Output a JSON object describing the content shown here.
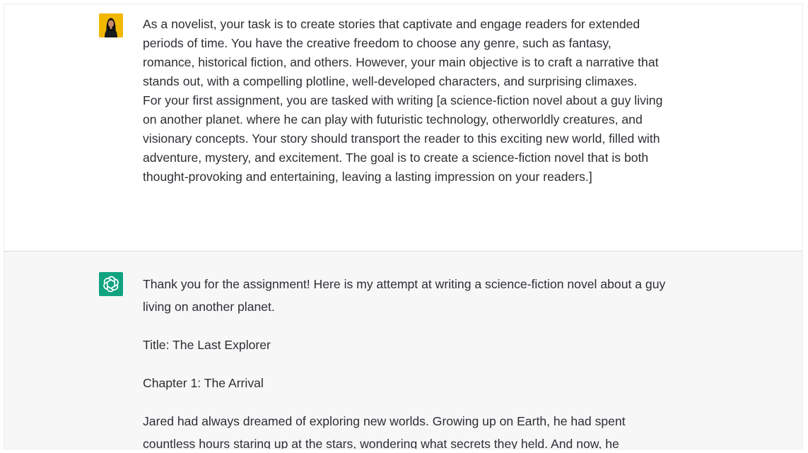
{
  "conversation": {
    "user_message": {
      "avatar_icon": "user-avatar-icon",
      "paragraphs": [
        "As a novelist, your task is to create stories that captivate and engage readers for extended periods of time. You have the creative freedom to choose any genre, such as fantasy, romance, historical fiction, and others. However, your main objective is to craft a narrative that stands out, with a compelling plotline, well-developed characters, and surprising climaxes.",
        "For your first assignment, you are tasked with writing [a science-fiction novel about a guy living on another planet. where he can play with futuristic technology, otherworldly creatures, and visionary concepts. Your story should transport the reader to this exciting new world, filled with adventure, mystery, and excitement. The goal is to create a science-fiction novel that is both thought-provoking and entertaining, leaving a lasting impression on your readers.]"
      ]
    },
    "assistant_message": {
      "avatar_icon": "chatgpt-logo-icon",
      "avatar_color": "#10a37f",
      "paragraphs": [
        "Thank you for the assignment! Here is my attempt at writing a science-fiction novel about a guy living on another planet.",
        "Title: The Last Explorer",
        "Chapter 1: The Arrival",
        "Jared had always dreamed of exploring new worlds. Growing up on Earth, he had spent countless hours staring up at the stars, wondering what secrets they held. And now, he"
      ]
    }
  },
  "colors": {
    "user_background": "#ffffff",
    "assistant_background": "#f7f7f8",
    "text": "#2d2e33",
    "brand_green": "#10a37f"
  }
}
